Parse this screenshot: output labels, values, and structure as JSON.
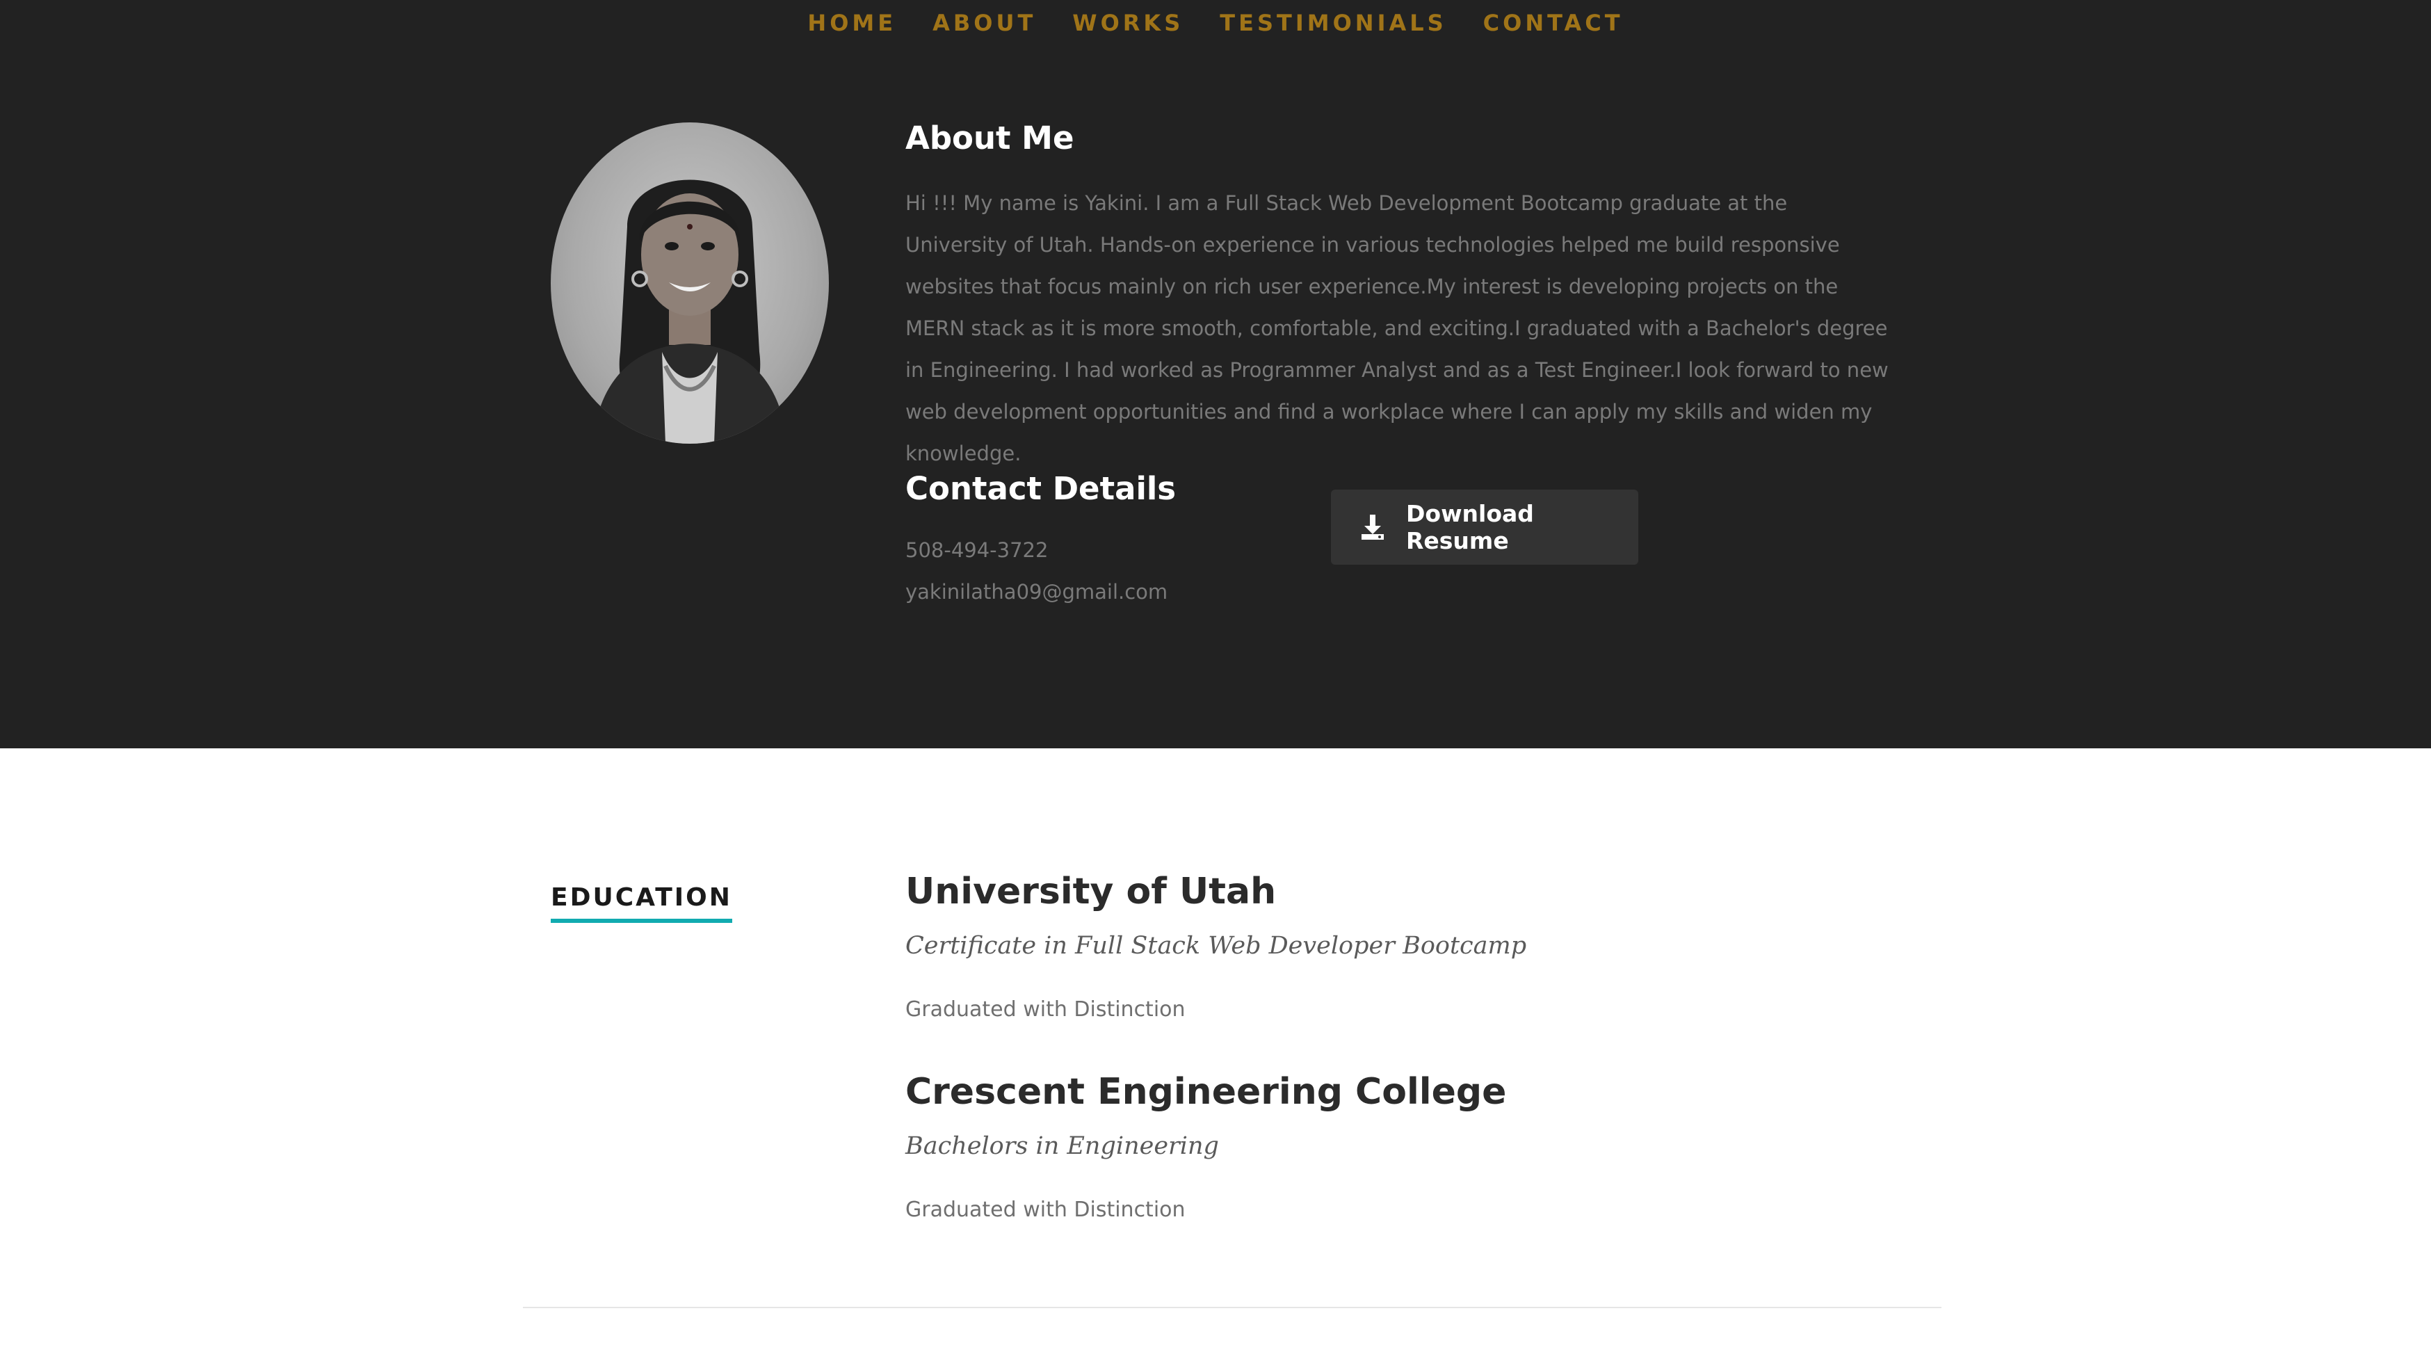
{
  "nav": {
    "items": [
      {
        "label": "HOME"
      },
      {
        "label": "ABOUT"
      },
      {
        "label": "WORKS"
      },
      {
        "label": "TESTIMONIALS"
      },
      {
        "label": "CONTACT"
      }
    ],
    "color": "#a07418"
  },
  "about": {
    "title": "About Me",
    "text": "Hi !!! My name is Yakini. I am a Full Stack Web Development Bootcamp graduate at the University of Utah. Hands-on experience in various technologies helped me build responsive websites that focus mainly on rich user experience.My interest is developing projects on the MERN stack as it is more smooth, comfortable, and exciting.I graduated with a Bachelor's degree in Engineering. I had worked as Programmer Analyst and as a Test Engineer.I look forward to new web development opportunities and find a workplace where I can apply my skills and widen my knowledge.",
    "background_color": "#222222"
  },
  "contact": {
    "title": "Contact Details",
    "phone": "508-494-3722",
    "email": "yakinilatha09@gmail.com",
    "download_label": "Download Resume",
    "download_icon": "download-icon"
  },
  "education": {
    "heading": "EDUCATION",
    "accent_color": "#11abb0",
    "schools": [
      {
        "name": "University of Utah",
        "degree": "Certificate in Full Stack Web Developer Bootcamp",
        "note": "Graduated with Distinction"
      },
      {
        "name": "Crescent Engineering College",
        "degree": "Bachelors in Engineering",
        "note": "Graduated with Distinction"
      }
    ]
  }
}
